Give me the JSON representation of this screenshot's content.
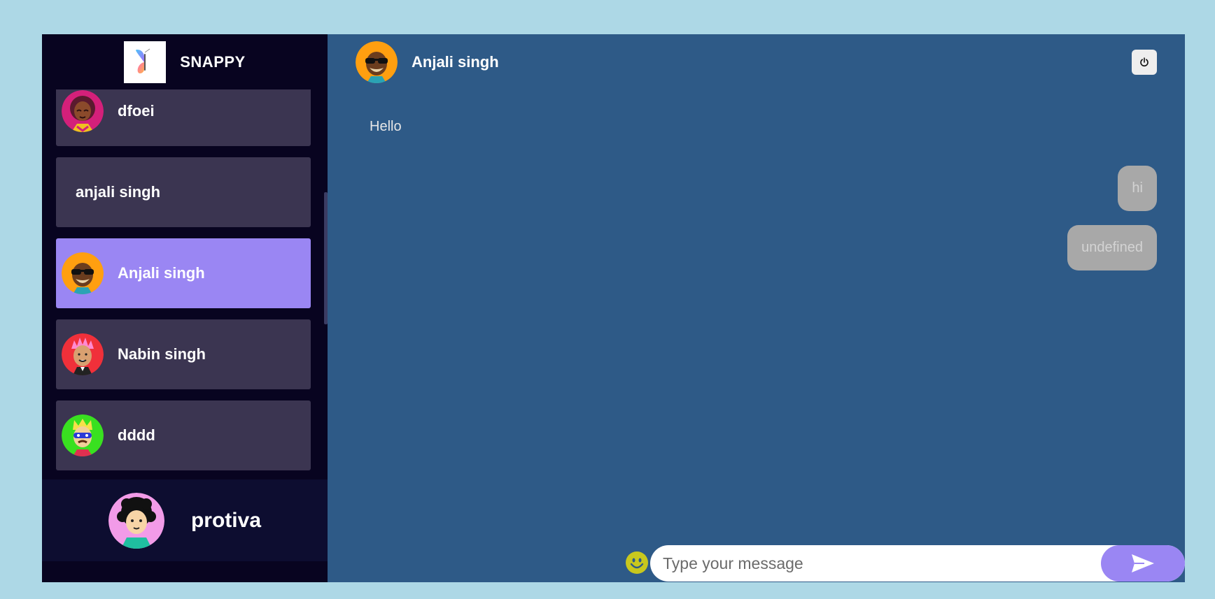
{
  "brand": {
    "name": "SNAPPY",
    "logo_icon": "butterfly-logo-icon"
  },
  "contacts": [
    {
      "name": "dfoei",
      "avatar": "avatar-pink-woman",
      "selected": false
    },
    {
      "name": "anjali singh",
      "avatar": "",
      "selected": false
    },
    {
      "name": "Anjali singh",
      "avatar": "avatar-sunglasses-orange",
      "selected": true
    },
    {
      "name": "Nabin singh",
      "avatar": "avatar-pink-hair-red",
      "selected": false
    },
    {
      "name": "dddd",
      "avatar": "avatar-masked-green",
      "selected": false
    }
  ],
  "current_user": {
    "name": "protiva",
    "avatar": "avatar-curly-hair-pink"
  },
  "chat": {
    "header_name": "Anjali singh",
    "logout_icon": "power-icon",
    "messages": [
      {
        "text": "Hello",
        "direction": "received"
      },
      {
        "text": "hi",
        "direction": "sent"
      },
      {
        "text": "undefined",
        "direction": "sent"
      }
    ],
    "input_placeholder": "Type your message",
    "input_value": "",
    "emoji_icon": "smiley-icon",
    "send_icon": "send-icon"
  },
  "colors": {
    "page_bg": "#add8e6",
    "sidebar_bg": "#080420",
    "contact_bg": "#3b3551",
    "contact_selected_bg": "#9a86f3",
    "chat_bg": "#2e5a87",
    "sent_bubble": "#a8a8a8",
    "send_button": "#9a86f3",
    "emoji": "#c8c81e"
  }
}
